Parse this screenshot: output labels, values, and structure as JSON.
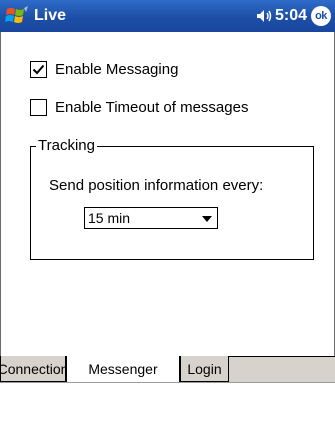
{
  "title_bar": {
    "app_title": "Live",
    "time": "5:04",
    "ok_label": "ok",
    "icons": [
      "windows-start-icon",
      "speaker-icon"
    ]
  },
  "settings": {
    "enable_messaging": {
      "label": "Enable Messaging",
      "checked": true
    },
    "enable_timeout": {
      "label": "Enable Timeout of messages",
      "checked": false
    }
  },
  "tracking": {
    "legend": "Tracking",
    "send_label": "Send position information every:",
    "interval": {
      "selected": "15 min"
    }
  },
  "tabs": [
    {
      "label": "Connection",
      "active": false
    },
    {
      "label": "Messenger",
      "active": true
    },
    {
      "label": "Login",
      "active": false
    }
  ],
  "colors": {
    "titlebar": "#1d4fa6",
    "tab_background": "#d8d2cc"
  }
}
